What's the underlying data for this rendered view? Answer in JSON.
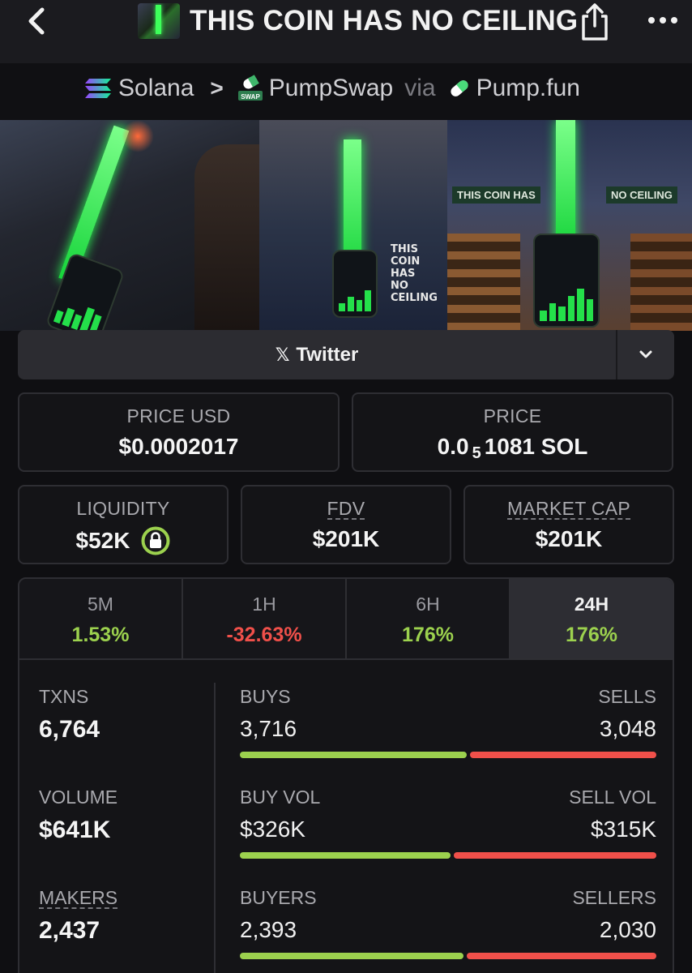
{
  "header": {
    "title": "THIS COIN HAS NO CEILING",
    "icons": [
      "back-icon",
      "share-icon",
      "more-icon"
    ]
  },
  "breadcrumb": {
    "chain": "Solana",
    "dex": "PumpSwap",
    "via_label": "via",
    "launchpad": "Pump.fun",
    "swap_badge": "SWAP"
  },
  "banner": {
    "sign_left": "THIS COIN HAS",
    "sign_right": "NO CEILING",
    "caption": "THIS COIN HAS NO CEILING",
    "caption_lines": [
      "THIS COIN",
      "HAS",
      "NO CEILING"
    ]
  },
  "social": {
    "x_glyph": "𝕏",
    "label": "Twitter"
  },
  "stats": {
    "price_usd": {
      "label": "PRICE USD",
      "value": "$0.0002017"
    },
    "price": {
      "label": "PRICE",
      "lead": "0.0",
      "sub": "5",
      "tail": "1081 SOL"
    },
    "liquidity": {
      "label": "LIQUIDITY",
      "value": "$52K"
    },
    "fdv": {
      "label": "FDV",
      "value": "$201K"
    },
    "market_cap": {
      "label": "MARKET CAP",
      "value": "$201K"
    }
  },
  "periods": [
    {
      "label": "5M",
      "value": "1.53%",
      "direction": "up"
    },
    {
      "label": "1H",
      "value": "-32.63%",
      "direction": "down"
    },
    {
      "label": "6H",
      "value": "176%",
      "direction": "up"
    },
    {
      "label": "24H",
      "value": "176%",
      "direction": "up",
      "selected": true
    }
  ],
  "txns": {
    "txns": {
      "label": "TXNS",
      "value": "6,764"
    },
    "volume": {
      "label": "VOLUME",
      "value": "$641K"
    },
    "makers": {
      "label": "MAKERS",
      "value": "2,437"
    },
    "rows": [
      {
        "left_label": "BUYS",
        "right_label": "SELLS",
        "left_value": "3,716",
        "right_value": "3,048",
        "left_share": 0.549
      },
      {
        "left_label": "BUY VOL",
        "right_label": "SELL VOL",
        "left_value": "$326K",
        "right_value": "$315K",
        "left_share": 0.509
      },
      {
        "left_label": "BUYERS",
        "right_label": "SELLERS",
        "left_value": "2,393",
        "right_value": "2,030",
        "left_share": 0.541
      }
    ]
  },
  "colors": {
    "positive": "#9cd14e",
    "negative": "#f0504a",
    "background": "#0f0f12",
    "card": "#141417"
  }
}
